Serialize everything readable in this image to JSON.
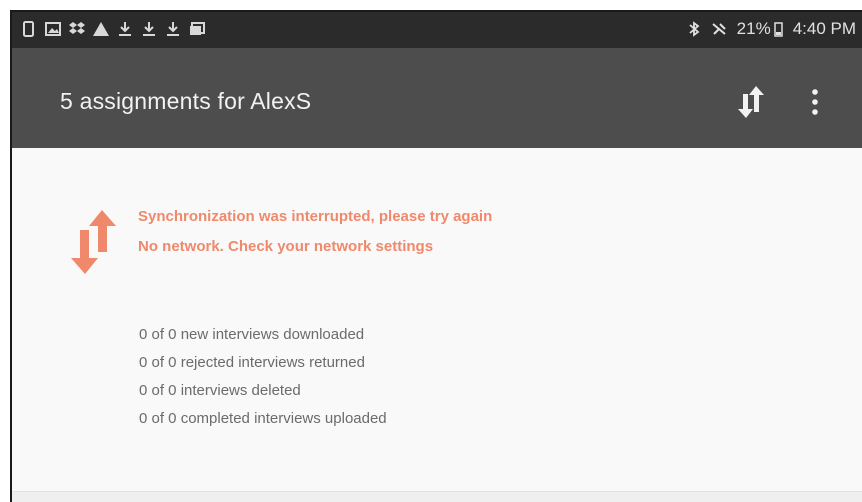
{
  "status_bar": {
    "left_icons": [
      "phone-icon",
      "image-icon",
      "dropbox-icon",
      "warning-icon",
      "download-icon",
      "download-icon",
      "download-icon",
      "photos-icon"
    ],
    "bluetooth_icon": "bluetooth-icon",
    "mute_icon": "vibrate-icon",
    "battery": "21%",
    "battery_icon": "battery-icon",
    "time": "4:40 PM"
  },
  "app_bar": {
    "title": "5 assignments for AlexS",
    "sync_icon": "sync-arrows-icon",
    "menu_icon": "more-vert-icon"
  },
  "sync_error": {
    "icon": "sync-arrows-icon",
    "line1": "Synchronization was interrupted, please try again",
    "line2": "No network. Check your network settings",
    "color": "#f0896b"
  },
  "stats": [
    "0 of 0 new interviews downloaded",
    "0 of 0 rejected interviews returned",
    "0 of 0 interviews deleted",
    "0 of 0 completed interviews uploaded"
  ],
  "colors": {
    "status_bar": "#2b2b2b",
    "app_bar": "#4d4d4d",
    "background": "#f9f9f9",
    "error_text": "#f0896b",
    "stat_text": "#6b6b6b"
  }
}
